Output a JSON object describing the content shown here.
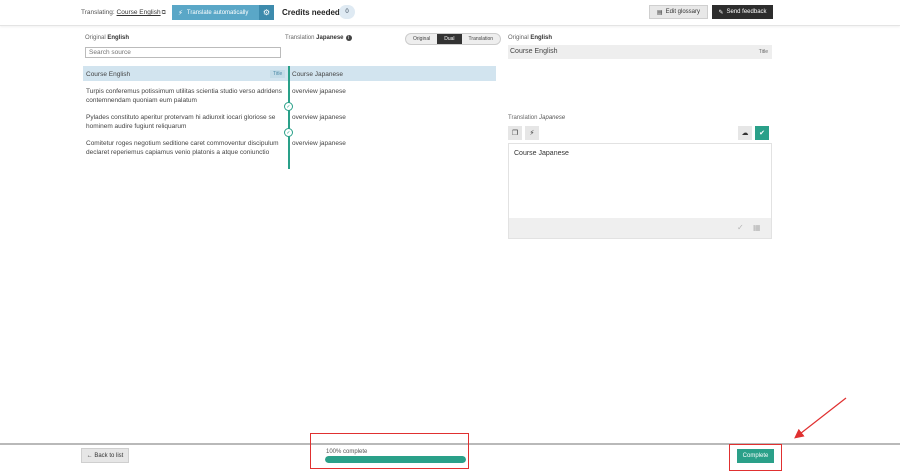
{
  "topbar": {
    "translating_label": "Translating:",
    "translating_link": "Course English",
    "auto_translate_label": "Translate automatically",
    "credits_label": "Credits needed",
    "credits_value": "0",
    "edit_glossary_label": "Edit glossary",
    "send_feedback_label": "Send feedback"
  },
  "columns": {
    "original_label": "Original",
    "original_lang": "English",
    "translation_label": "Translation",
    "translation_lang": "Japanese",
    "view_modes": [
      "Original",
      "Dual",
      "Translation"
    ],
    "active_view_mode": "Dual",
    "search_placeholder": "Search source"
  },
  "rows": [
    {
      "source": "Course English",
      "target": "Course Japanese",
      "tag": "Title",
      "selected": true
    },
    {
      "source": "Turpis conferemus potissimum utilitas scientia studio verso adridens contemnendam quoniam eum palatum",
      "target": "overview japanese",
      "selected": false
    },
    {
      "source": "Pylades constituto aperitur protervam hi adiunxit iocari gloriose se hominem audire fugiunt reliquarum",
      "target": "overview japanese",
      "selected": false
    },
    {
      "source": "Comitetur roges negotium seditione caret commoventur discipulum declaret reperiemus capiamus venio platonis a atque coniunctio",
      "target": "overview japanese",
      "selected": false
    }
  ],
  "editor": {
    "original_label": "Original",
    "original_lang": "English",
    "source_text": "Course English",
    "source_tag": "Title",
    "translation_label": "Translation",
    "translation_lang": "Japanese",
    "translation_text": "Course Japanese"
  },
  "bottombar": {
    "back_label": "← Back to list",
    "progress_label": "100% complete",
    "progress_percent": 100,
    "complete_label": "Complete"
  },
  "colors": {
    "accent_green": "#2aa089",
    "accent_blue": "#5aa7c7",
    "highlight_red": "#e03030"
  }
}
